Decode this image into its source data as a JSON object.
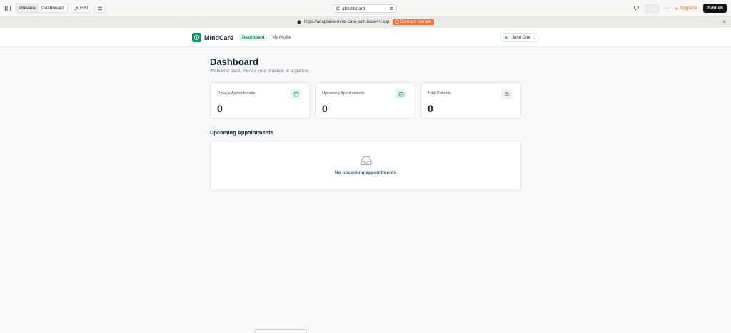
{
  "editor": {
    "preview_label": "Preview",
    "dashboard_label": "Dashboard",
    "edit_label": "Edit",
    "url_path": "/dashboard",
    "upgrade_label": "Upgrade",
    "publish_label": "Publish",
    "icons": [
      "sidebar-toggle-icon",
      "pencil-icon",
      "grid-icon",
      "refresh-icon",
      "settings-icon",
      "chat-icon",
      "more-icon",
      "sparkle-icon"
    ]
  },
  "domain_bar": {
    "url": "https://adaptable-mind-care-path.base44.app",
    "connect_label": "Connect domain"
  },
  "app": {
    "brand": "MindCare",
    "nav": [
      "Dashboard",
      "My Profile"
    ],
    "user": {
      "initials": "JD",
      "name": "John Doe"
    },
    "accent": "#14906a"
  },
  "page": {
    "title": "Dashboard",
    "subtitle": "Welcome back. Here's your practice at a glance."
  },
  "stats": [
    {
      "label": "Today's Appointments",
      "value": "0",
      "icon": "calendar-icon"
    },
    {
      "label": "Upcoming Appointments",
      "value": "0",
      "icon": "calendar-check-icon"
    },
    {
      "label": "Total Patients",
      "value": "0",
      "icon": "users-icon"
    }
  ],
  "upcoming": {
    "title": "Upcoming Appointments",
    "empty_text": "No upcoming appointments",
    "icon": "inbox-icon"
  }
}
